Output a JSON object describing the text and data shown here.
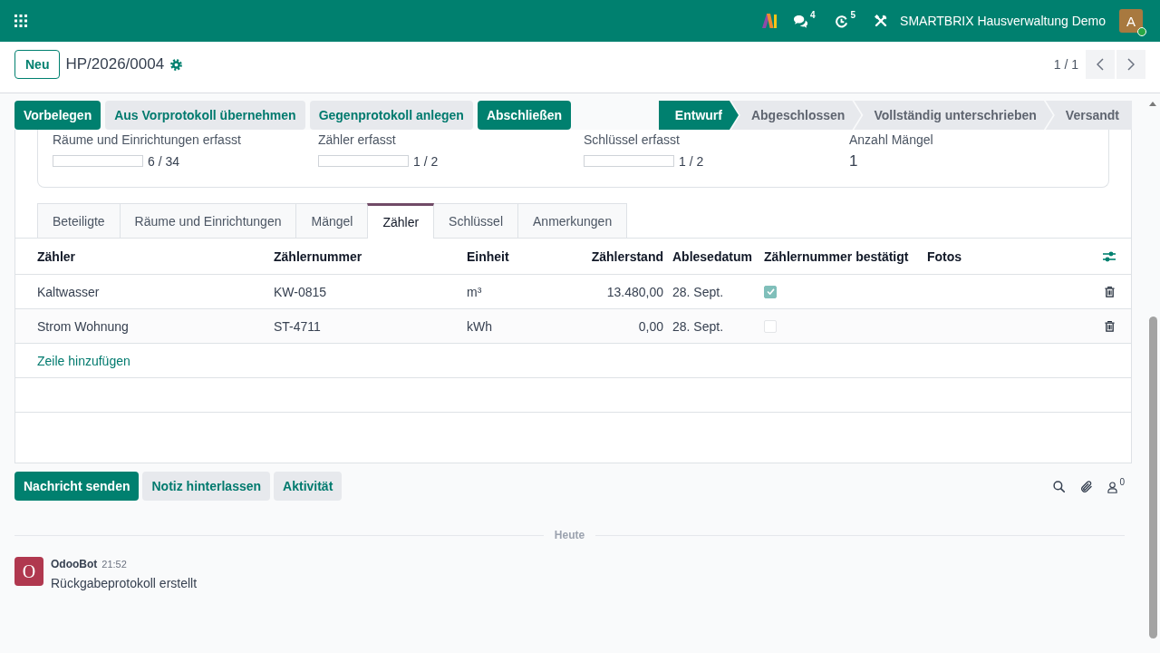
{
  "navbar": {
    "notifications": [
      {
        "kind": "messages",
        "count": "4"
      },
      {
        "kind": "activities",
        "count": "5"
      }
    ],
    "company": "SMARTBRIX Hausverwaltung Demo",
    "avatar_letter": "A",
    "online": true
  },
  "control_panel": {
    "new_button": "Neu",
    "record_name": "HP/2026/0004",
    "pager": "1 / 1"
  },
  "action_buttons": [
    {
      "label": "Vorbelegen",
      "kind": "primary"
    },
    {
      "label": "Aus Vorprotokoll übernehmen",
      "kind": "secondary"
    },
    {
      "label": "Gegenprotokoll anlegen",
      "kind": "secondary"
    },
    {
      "label": "Abschließen",
      "kind": "primary"
    }
  ],
  "status_steps": [
    {
      "label": "Entwurf",
      "selected": true
    },
    {
      "label": "Abgeschlossen",
      "selected": false
    },
    {
      "label": "Vollständig unterschrieben",
      "selected": false
    },
    {
      "label": "Versandt",
      "selected": false
    }
  ],
  "summary": [
    {
      "kind": "progress",
      "label": "Räume und Einrichtungen erfasst",
      "level": 0,
      "value": "6 / 34"
    },
    {
      "kind": "progress",
      "label": "Zähler erfasst",
      "level": 0,
      "value": "1 / 2"
    },
    {
      "kind": "progress",
      "label": "Schlüssel erfasst",
      "level": 0,
      "value": "1 / 2"
    },
    {
      "kind": "number",
      "label": "Anzahl Mängel",
      "value": "1"
    }
  ],
  "tabs": [
    {
      "label": "Beteiligte",
      "selected": false
    },
    {
      "label": "Räume und Einrichtungen",
      "selected": false
    },
    {
      "label": "Mängel",
      "selected": false
    },
    {
      "label": "Zähler",
      "selected": true
    },
    {
      "label": "Schlüssel",
      "selected": false
    },
    {
      "label": "Anmerkungen",
      "selected": false
    }
  ],
  "table": {
    "columns": [
      {
        "label": "Zähler",
        "kind": "text"
      },
      {
        "label": "Zählernummer",
        "kind": "text"
      },
      {
        "label": "Einheit",
        "kind": "text"
      },
      {
        "label": "Zählerstand",
        "kind": "number"
      },
      {
        "label": "Ablesedatum",
        "kind": "text"
      },
      {
        "label": "Zählernummer bestätigt",
        "kind": "checkbox"
      },
      {
        "label": "Fotos",
        "kind": "text"
      }
    ],
    "rows": [
      {
        "meter": "Kaltwasser",
        "number": "KW-0815",
        "unit": "m³",
        "reading": "13.480,00",
        "date": "28. Sept.",
        "confirmed": true
      },
      {
        "meter": "Strom Wohnung",
        "number": "ST-4711",
        "unit": "kWh",
        "reading": "0,00",
        "date": "28. Sept.",
        "confirmed": false
      }
    ],
    "add_line": "Zeile hinzufügen"
  },
  "chatter": {
    "buttons": [
      {
        "label": "Nachricht senden",
        "kind": "primary"
      },
      {
        "label": "Notiz hinterlassen",
        "kind": "secondary"
      },
      {
        "label": "Aktivität",
        "kind": "secondary"
      }
    ],
    "follower_count": "0",
    "date_separator": "Heute",
    "messages": [
      {
        "author": "OdooBot",
        "avatar_letter": "O",
        "time": "21:52",
        "body": "Rückgabeprotokoll erstellt"
      }
    ]
  }
}
